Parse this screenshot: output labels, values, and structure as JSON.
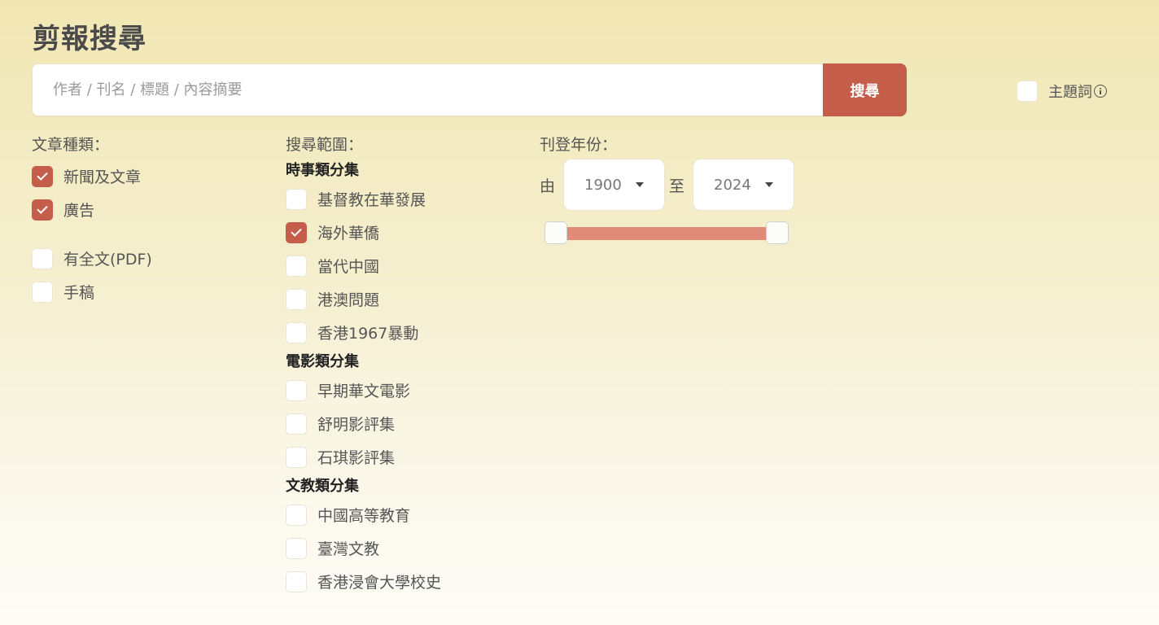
{
  "header": {
    "title": "剪報搜尋"
  },
  "search": {
    "placeholder": "作者 / 刊名 / 標題 / 內容摘要",
    "button_label": "搜尋"
  },
  "topic_toggle": {
    "label": "主題詞",
    "checked": false,
    "icon": "info-icon"
  },
  "article_type": {
    "label": "文章種類：",
    "items": [
      {
        "label": "新聞及文章",
        "checked": true
      },
      {
        "label": "廣告",
        "checked": true
      },
      {
        "label": "有全文(PDF)",
        "checked": false
      },
      {
        "label": "手稿",
        "checked": false
      }
    ]
  },
  "scope": {
    "label": "搜尋範圍：",
    "groups": [
      {
        "title": "時事類分集",
        "items": [
          {
            "label": "基督教在華發展",
            "checked": false
          },
          {
            "label": "海外華僑",
            "checked": true
          },
          {
            "label": "當代中國",
            "checked": false
          },
          {
            "label": "港澳問題",
            "checked": false
          },
          {
            "label": "香港1967暴動",
            "checked": false
          }
        ]
      },
      {
        "title": "電影類分集",
        "items": [
          {
            "label": "早期華文電影",
            "checked": false
          },
          {
            "label": "舒明影評集",
            "checked": false
          },
          {
            "label": "石琪影評集",
            "checked": false
          }
        ]
      },
      {
        "title": "文教類分集",
        "items": [
          {
            "label": "中國高等教育",
            "checked": false
          },
          {
            "label": "臺灣文教",
            "checked": false
          },
          {
            "label": "香港浸會大學校史",
            "checked": false
          }
        ]
      }
    ]
  },
  "year": {
    "label": "刊登年份：",
    "from_label": "由",
    "to_label": "至",
    "from_value": "1900",
    "to_value": "2024",
    "slider": {
      "min_fraction": 0,
      "max_fraction": 1
    }
  },
  "colors": {
    "accent": "#c45e4b",
    "slider_track": "#e08a78"
  }
}
